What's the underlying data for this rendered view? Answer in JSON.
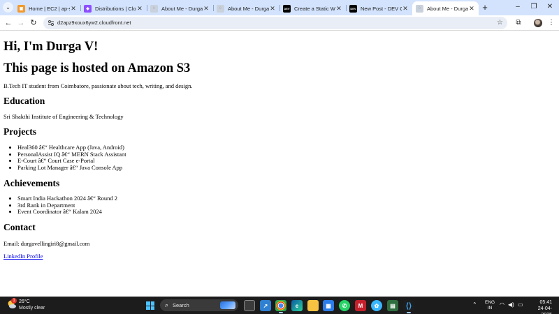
{
  "browser": {
    "tabs": [
      {
        "title": "Home | EC2 | ap-south-1",
        "favicon_color": "#f29a2e",
        "favicon_glyph": "▣",
        "active": false
      },
      {
        "title": "Distributions | CloudFront",
        "favicon_color": "#8c4fff",
        "favicon_glyph": "◆",
        "active": false
      },
      {
        "title": "About Me - Durga V",
        "favicon_color": "#c9d1dc",
        "favicon_glyph": "◌",
        "active": false
      },
      {
        "title": "About Me - Durga V",
        "favicon_color": "#c9d1dc",
        "favicon_glyph": "◌",
        "active": false
      },
      {
        "title": "Create a Static Website",
        "favicon_color": "#000000",
        "favicon_glyph": "DEV",
        "active": false
      },
      {
        "title": "New Post - DEV Community",
        "favicon_color": "#000000",
        "favicon_glyph": "DEV",
        "active": false
      },
      {
        "title": "About Me - Durga V",
        "favicon_color": "#c9d1dc",
        "favicon_glyph": "◌",
        "active": true
      }
    ],
    "url": "d2apz9xoux6yw2.cloudfront.net"
  },
  "page": {
    "heading": "Hi, I'm Durga V!",
    "subheading": "This page is hosted on Amazon S3",
    "intro": "B.Tech IT student from Coimbatore, passionate about tech, writing, and design.",
    "education": {
      "title": "Education",
      "text": "Sri Shakthi Institute of Engineering & Technology"
    },
    "projects": {
      "title": "Projects",
      "items": [
        "Heal360 â€“ Healthcare App (Java, Android)",
        "PersonalAssist IQ â€“ MERN Stack Assistant",
        "E-Court â€“ Court Case e-Portal",
        "Parking Lot Manager â€“ Java Console App"
      ]
    },
    "achievements": {
      "title": "Achievements",
      "items": [
        "Smart India Hackathon 2024 â€“ Round 2",
        "3rd Rank in Department",
        "Event Coordinator â€“ Kalam 2024"
      ]
    },
    "contact": {
      "title": "Contact",
      "email": "Email: durgavellingiri8@gmail.com",
      "link": "LinkedIn Profile"
    }
  },
  "taskbar": {
    "weather": {
      "temp": "26°C",
      "condition": "Mostly clear",
      "badge": "1"
    },
    "search_label": "Search",
    "language": "ENG",
    "region": "IN",
    "time": "05:41",
    "date": "24-04-2025"
  }
}
